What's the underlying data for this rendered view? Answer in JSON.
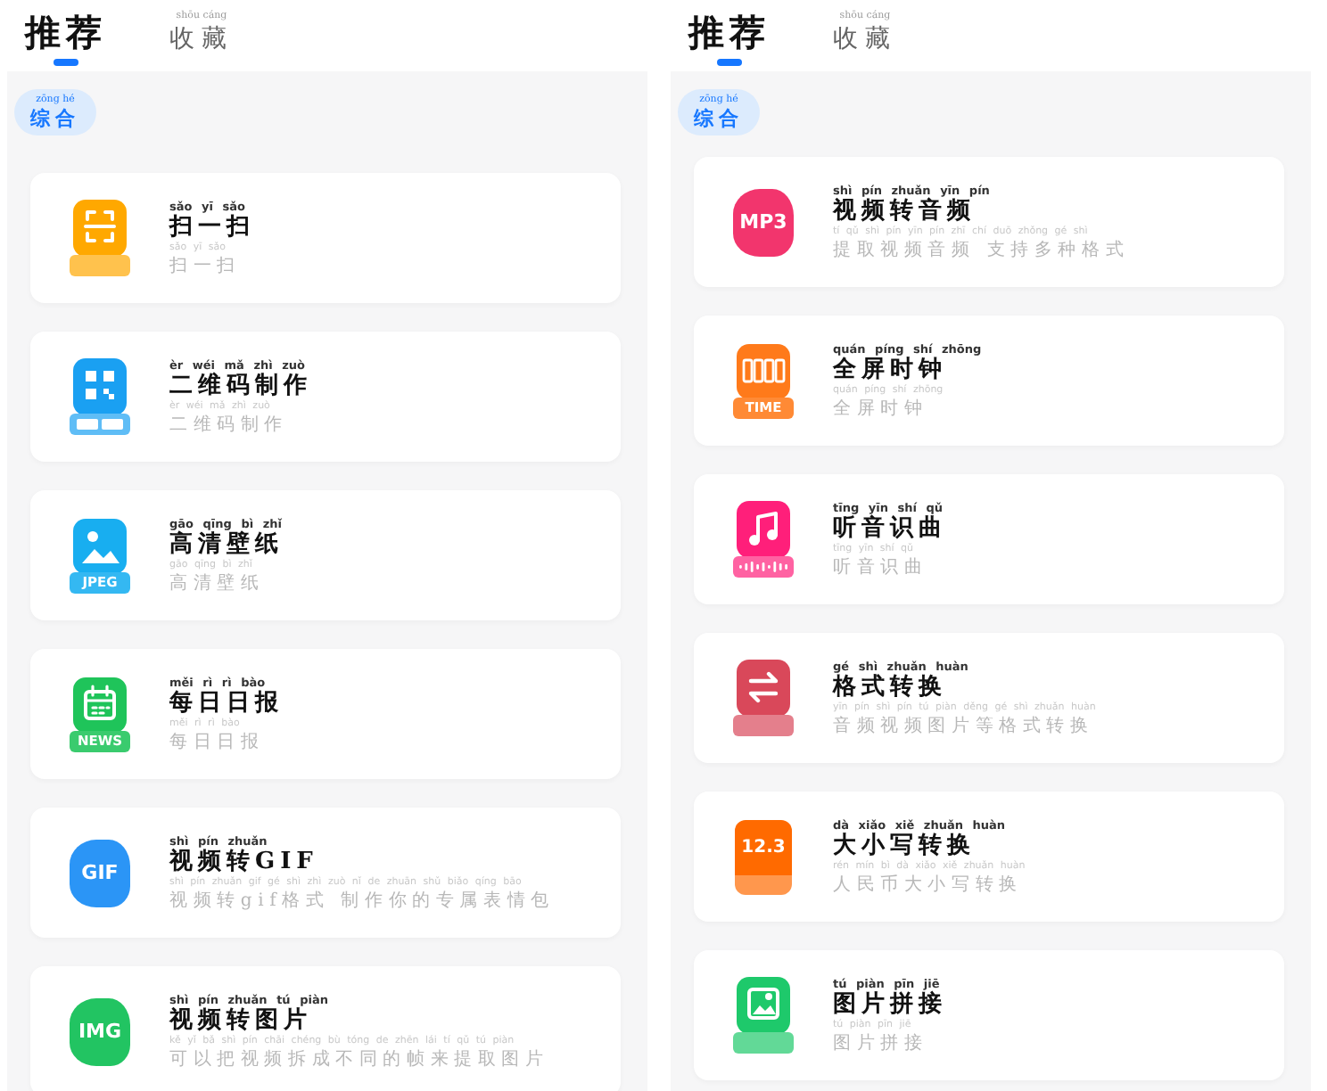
{
  "panels": [
    {
      "tabs": [
        {
          "label": "推荐",
          "selected": true
        },
        {
          "label": "收藏",
          "pinyin": "shōu cáng",
          "selected": false
        }
      ],
      "filter_chip": {
        "pinyin": "zōng hé",
        "label": "综合",
        "selected": true
      },
      "items": [
        {
          "title_pinyin": "sǎo yī sǎo",
          "title": "扫一扫",
          "desc_pinyin": "sǎo yī sǎo",
          "desc": "扫一扫",
          "icon": {
            "kind": "scan",
            "color": "#ffa800"
          }
        },
        {
          "title_pinyin": "èr wéi mǎ zhì zuò",
          "title": "二维码制作",
          "desc_pinyin": "èr wéi mǎ zhì zuò",
          "desc": "二维码制作",
          "icon": {
            "kind": "qrcode",
            "color": "#1aa0f2"
          }
        },
        {
          "title_pinyin": "gāo qīng bì zhǐ",
          "title": "高清壁纸",
          "desc_pinyin": "gāo qīng bì zhǐ",
          "desc": "高清壁纸",
          "icon": {
            "kind": "image",
            "color": "#18aef0",
            "label": "JPEG"
          }
        },
        {
          "title_pinyin": "měi rì rì bào",
          "title": "每日日报",
          "desc_pinyin": "měi rì rì bào",
          "desc": "每日日报",
          "icon": {
            "kind": "calendar",
            "color": "#1fc45a",
            "label": "NEWS"
          }
        },
        {
          "title_pinyin": "shì pín zhuǎn",
          "title": "视频转GIF",
          "desc_pinyin": "shì pín zhuǎn gif gé shì zhì zuò nǐ de zhuān shǔ biǎo qíng bāo",
          "desc": "视频转gif格式 制作你的专属表情包",
          "icon": {
            "kind": "blob",
            "color": "#2b95f6",
            "label": "GIF"
          }
        },
        {
          "title_pinyin": "shì pín zhuǎn tú piàn",
          "title": "视频转图片",
          "desc_pinyin": "kě yǐ bǎ shì pín chāi chéng bù tóng de zhēn lái tí qǔ tú piàn",
          "desc": "可以把视频拆成不同的帧来提取图片",
          "icon": {
            "kind": "blob",
            "color": "#22c462",
            "label": "IMG"
          }
        }
      ]
    },
    {
      "tabs": [
        {
          "label": "推荐",
          "selected": true
        },
        {
          "label": "收藏",
          "pinyin": "shōu cáng",
          "selected": false
        }
      ],
      "filter_chip": {
        "pinyin": "zōng hé",
        "label": "综合",
        "selected": true
      },
      "items": [
        {
          "title_pinyin": "shì pín zhuǎn yīn pín",
          "title": "视频转音频",
          "desc_pinyin": "tí qǔ shì pín yīn pín zhī chí duō zhǒng gé shì",
          "desc": "提取视频音频 支持多种格式",
          "icon": {
            "kind": "blob",
            "color": "#f2356d",
            "label": "MP3"
          }
        },
        {
          "title_pinyin": "quán píng shí zhōng",
          "title": "全屏时钟",
          "desc_pinyin": "quán píng shí zhōng",
          "desc": "全屏时钟",
          "icon": {
            "kind": "clock",
            "color": "#ff7a1a",
            "label": "TIME"
          }
        },
        {
          "title_pinyin": "tīng yīn shí qǔ",
          "title": "听音识曲",
          "desc_pinyin": "tīng yīn shí qǔ",
          "desc": "听音识曲",
          "icon": {
            "kind": "music",
            "color": "#ff1f7a"
          }
        },
        {
          "title_pinyin": "gé shì zhuǎn huàn",
          "title": "格式转换",
          "desc_pinyin": "yīn pín shì pín tú piàn děng gé shì zhuǎn huàn",
          "desc": "音频视频图片等格式转换",
          "icon": {
            "kind": "convert",
            "color": "#d9485a"
          }
        },
        {
          "title_pinyin": "dà xiǎo xiě zhuǎn huàn",
          "title": "大小写转换",
          "desc_pinyin": "rén mín bì dà xiǎo xiě zhuǎn huàn",
          "desc": "人民币大小写转换",
          "icon": {
            "kind": "number",
            "color": "#ff6a00",
            "label": "12.3"
          }
        },
        {
          "title_pinyin": "tú piàn pīn jiē",
          "title": "图片拼接",
          "desc_pinyin": "tú piàn pīn jiē",
          "desc": "图片拼接",
          "icon": {
            "kind": "collage",
            "color": "#1ec96b"
          }
        }
      ]
    }
  ]
}
